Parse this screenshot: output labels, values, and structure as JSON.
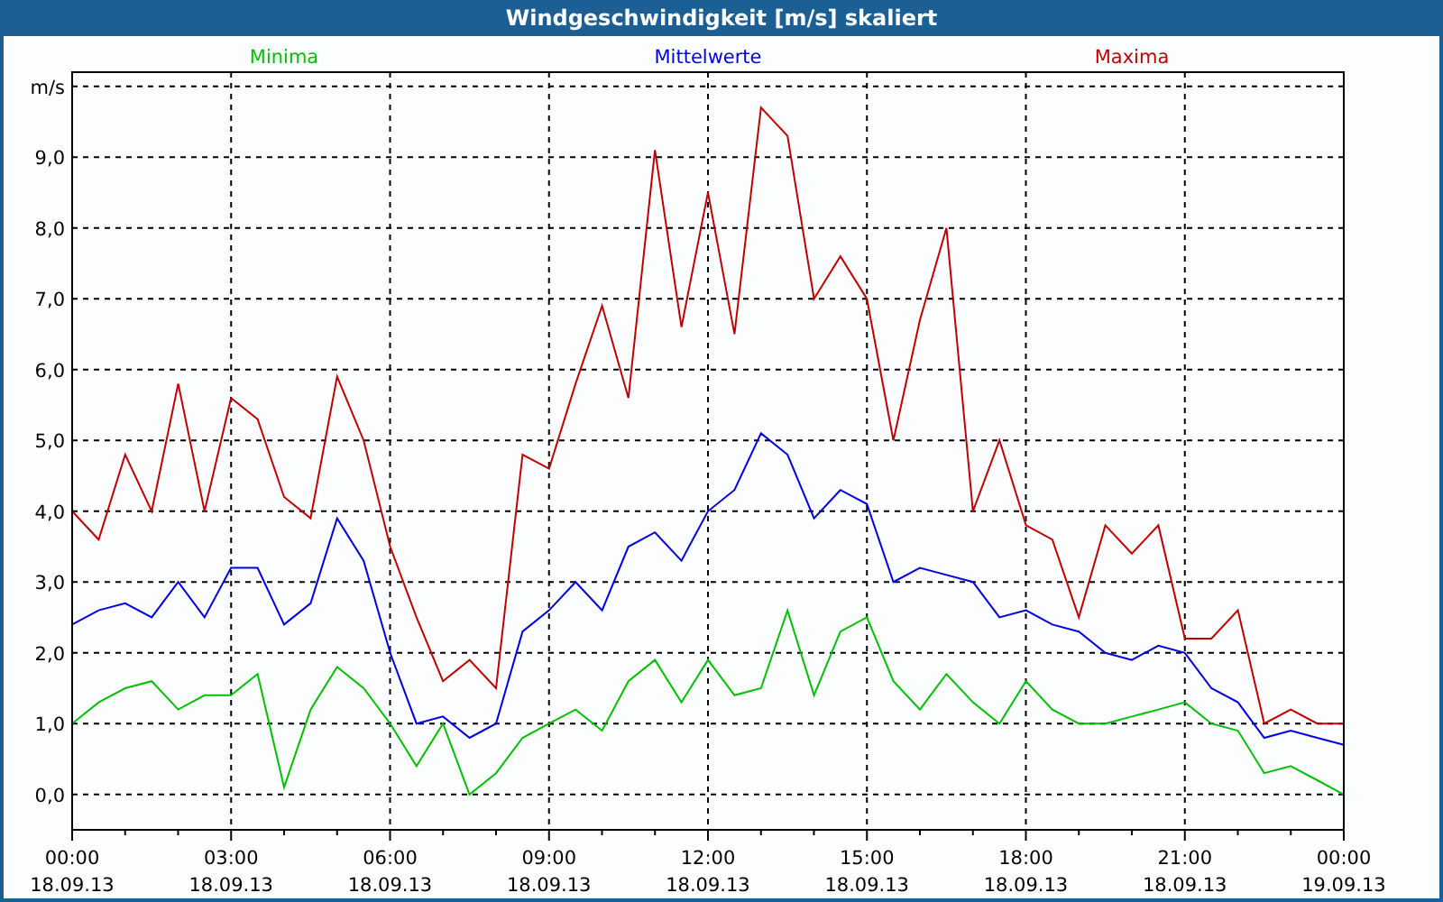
{
  "window": {
    "title": "Windgeschwindigkeit [m/s] skaliert"
  },
  "chart": {
    "chart_data": {
      "type": "line",
      "grid": true,
      "ylabel": "m/s",
      "ylim": [
        -0.5,
        10.2
      ],
      "categories": [
        "00:00\n18.09.13",
        null,
        null,
        null,
        null,
        null,
        "03:00\n18.09.13",
        null,
        null,
        null,
        null,
        null,
        "06:00\n18.09.13",
        null,
        null,
        null,
        null,
        null,
        "09:00\n18.09.13",
        null,
        null,
        null,
        null,
        null,
        "12:00\n18.09.13",
        null,
        null,
        null,
        null,
        null,
        "15:00\n18.09.13",
        null,
        null,
        null,
        null,
        null,
        "18:00\n18.09.13",
        null,
        null,
        null,
        null,
        null,
        "21:00\n18.09.13",
        null,
        null,
        null,
        null,
        null,
        "00:00\n19.09.13"
      ],
      "series": [
        {
          "name": "Minima",
          "color": "#00c000",
          "values": [
            1.0,
            1.3,
            1.5,
            1.6,
            1.2,
            1.4,
            1.4,
            1.7,
            0.1,
            1.2,
            1.8,
            1.5,
            1.0,
            0.4,
            1.0,
            0.0,
            0.3,
            0.8,
            1.0,
            1.2,
            0.9,
            1.6,
            1.9,
            1.3,
            1.9,
            1.4,
            1.5,
            2.6,
            1.4,
            2.3,
            2.5,
            1.6,
            1.2,
            1.7,
            1.3,
            1.0,
            1.6,
            1.2,
            1.0,
            1.0,
            1.1,
            1.2,
            1.3,
            1.0,
            0.9,
            0.3,
            0.4,
            0.2,
            0.0
          ]
        },
        {
          "name": "Mittelwerte",
          "color": "#0000e0",
          "values": [
            2.4,
            2.6,
            2.7,
            2.5,
            3.0,
            2.5,
            3.2,
            3.2,
            2.4,
            2.7,
            3.9,
            3.3,
            2.0,
            1.0,
            1.1,
            0.8,
            1.0,
            2.3,
            2.6,
            3.0,
            2.6,
            3.5,
            3.7,
            3.3,
            4.0,
            4.3,
            5.1,
            4.8,
            3.9,
            4.3,
            4.1,
            3.0,
            3.2,
            3.1,
            3.0,
            2.5,
            2.6,
            2.4,
            2.3,
            2.0,
            1.9,
            2.1,
            2.0,
            1.5,
            1.3,
            0.8,
            0.9,
            0.8,
            0.7
          ]
        },
        {
          "name": "Maxima",
          "color": "#c00000",
          "values": [
            4.0,
            3.6,
            4.8,
            4.0,
            5.8,
            4.0,
            5.6,
            5.3,
            4.2,
            3.9,
            5.9,
            5.0,
            3.5,
            2.5,
            1.6,
            1.9,
            1.5,
            4.8,
            4.6,
            5.8,
            6.9,
            5.6,
            9.1,
            6.6,
            8.5,
            6.5,
            9.7,
            9.3,
            7.0,
            7.6,
            7.0,
            5.0,
            6.7,
            8.0,
            4.0,
            5.0,
            3.8,
            3.6,
            2.5,
            3.8,
            3.4,
            3.8,
            2.2,
            2.2,
            2.6,
            1.0,
            1.2,
            1.0,
            1.0
          ]
        }
      ],
      "yticks": [
        {
          "value": 0,
          "label": "0,0"
        },
        {
          "value": 1,
          "label": "1,0"
        },
        {
          "value": 2,
          "label": "2,0"
        },
        {
          "value": 3,
          "label": "3,0"
        },
        {
          "value": 4,
          "label": "4,0"
        },
        {
          "value": 5,
          "label": "5,0"
        },
        {
          "value": 6,
          "label": "6,0"
        },
        {
          "value": 7,
          "label": "7,0"
        },
        {
          "value": 8,
          "label": "8,0"
        },
        {
          "value": 9,
          "label": "9,0"
        }
      ]
    }
  }
}
